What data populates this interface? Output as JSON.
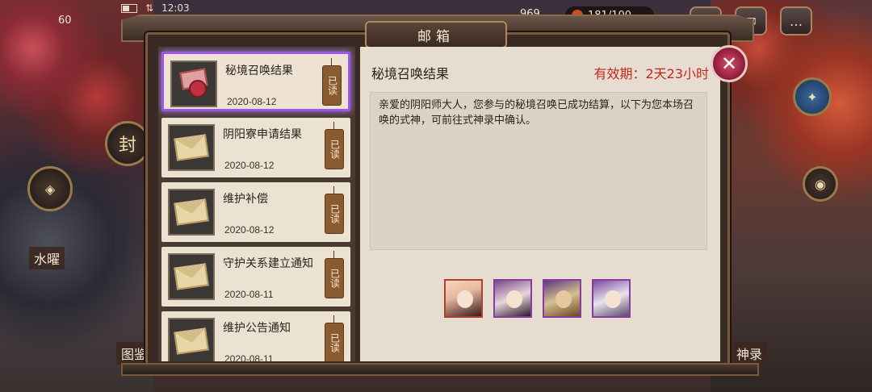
{
  "status": {
    "time": "12:03"
  },
  "resources": {
    "count": "181/100",
    "partial": "969"
  },
  "background": {
    "left_badge": "封",
    "left_label": "水曜",
    "bottom_left_label": "图鉴",
    "bottom_right_label": "神录",
    "level": "60"
  },
  "modal": {
    "title": "邮箱"
  },
  "mails": [
    {
      "title": "秘境召唤结果",
      "date": "2020-08-12",
      "status": "已读",
      "icon": "gift-icon",
      "selected": true
    },
    {
      "title": "阴阳寮申请结果",
      "date": "2020-08-12",
      "status": "已读",
      "icon": "envelope-icon"
    },
    {
      "title": "维护补偿",
      "date": "2020-08-12",
      "status": "已读",
      "icon": "envelope-icon"
    },
    {
      "title": "守护关系建立通知",
      "date": "2020-08-11",
      "status": "已读",
      "icon": "envelope-icon"
    },
    {
      "title": "维护公告通知",
      "date": "2020-08-11",
      "status": "已读",
      "icon": "envelope-icon"
    }
  ],
  "detail": {
    "title": "秘境召唤结果",
    "validity": "有效期：2天23小时",
    "body": "亲爱的阴阳师大人，您参与的秘境召唤已成功结算，以下为您本场召唤的式神，可前往式神录中确认。",
    "rewards": [
      "shikigami-portrait-1",
      "shikigami-portrait-2",
      "shikigami-portrait-3",
      "shikigami-portrait-4"
    ]
  },
  "close_label": "✕",
  "colors": {
    "selected_border": "#9b57e8",
    "validity": "#c0281e",
    "panel": "#e6ddd0"
  }
}
